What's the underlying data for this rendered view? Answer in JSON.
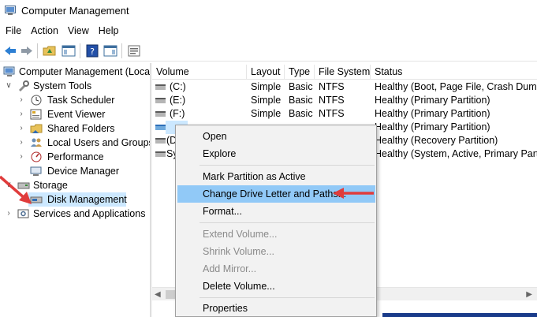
{
  "window": {
    "title": "Computer Management"
  },
  "menu": [
    "File",
    "Action",
    "View",
    "Help"
  ],
  "tree": {
    "root": "Computer Management (Local",
    "system_tools": "System Tools",
    "task_scheduler": "Task Scheduler",
    "event_viewer": "Event Viewer",
    "shared_folders": "Shared Folders",
    "local_users": "Local Users and Groups",
    "performance": "Performance",
    "device_manager": "Device Manager",
    "storage": "Storage",
    "disk_management": "Disk Management",
    "services": "Services and Applications"
  },
  "list": {
    "headers": [
      "Volume",
      "Layout",
      "Type",
      "File System",
      "Status"
    ],
    "rows": [
      [
        "(C:)",
        "Simple",
        "Basic",
        "NTFS",
        "Healthy (Boot, Page File, Crash Dump,"
      ],
      [
        "(E:)",
        "Simple",
        "Basic",
        "NTFS",
        "Healthy (Primary Partition)"
      ],
      [
        "(F:)",
        "Simple",
        "Basic",
        "NTFS",
        "Healthy (Primary Partition)"
      ],
      [
        "",
        "",
        "",
        "",
        "Healthy (Primary Partition)"
      ],
      [
        "(D",
        "",
        "",
        "",
        "Healthy (Recovery Partition)"
      ],
      [
        "Sy",
        "",
        "",
        "",
        "Healthy (System, Active, Primary Partiti"
      ]
    ]
  },
  "context_menu": {
    "open": "Open",
    "explore": "Explore",
    "mark_active": "Mark Partition as Active",
    "change_letter": "Change Drive Letter and Paths...",
    "format": "Format...",
    "extend": "Extend Volume...",
    "shrink": "Shrink Volume...",
    "add_mirror": "Add Mirror...",
    "delete": "Delete Volume...",
    "properties": "Properties"
  },
  "colors": {
    "highlight": "#91c9f7",
    "selection": "#cce8ff",
    "arrow": "#e03c3c"
  }
}
